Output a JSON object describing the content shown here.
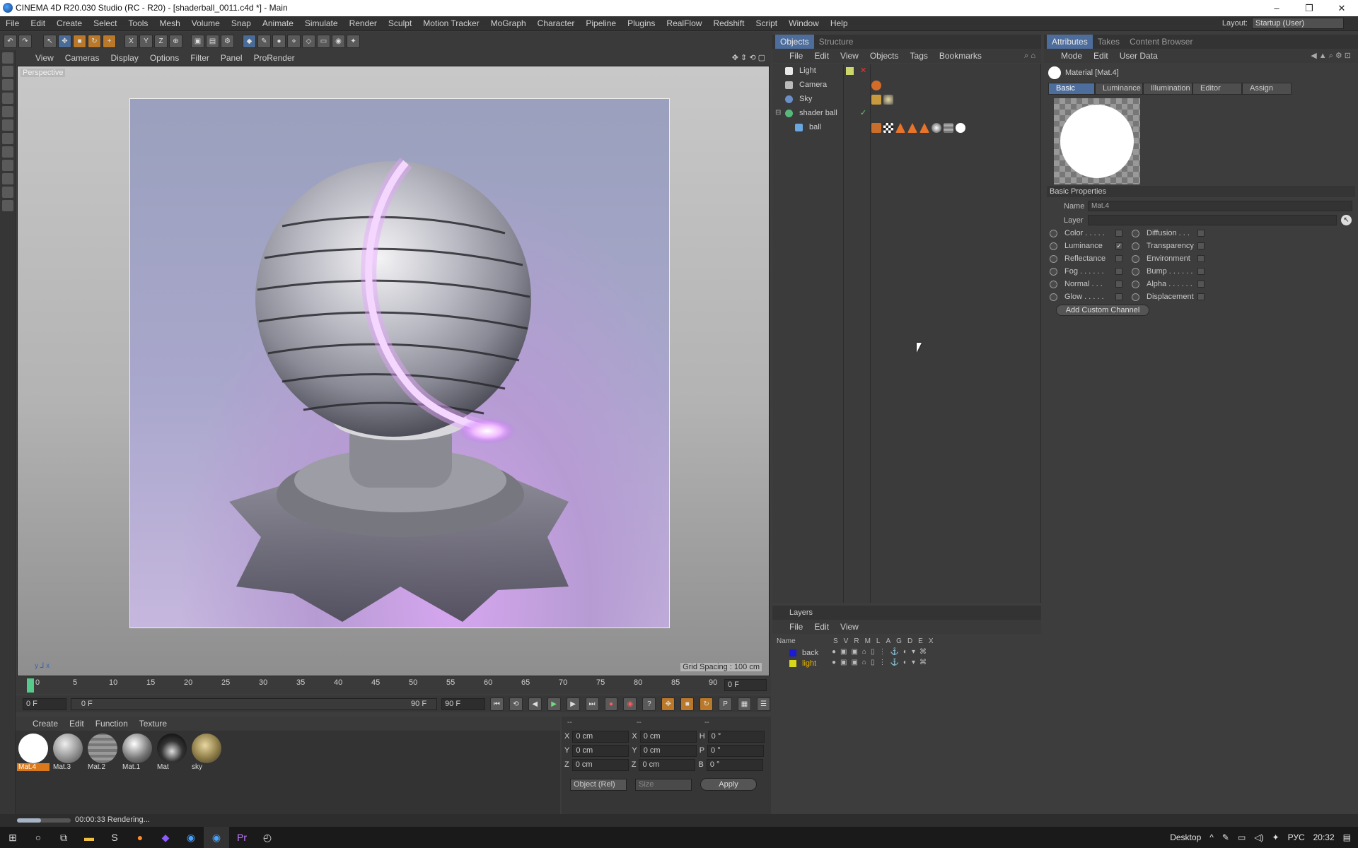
{
  "window": {
    "title": "CINEMA 4D R20.030 Studio (RC - R20) - [shaderball_0011.c4d *] - Main",
    "controls": [
      "–",
      "❐",
      "✕"
    ]
  },
  "menubar": {
    "items": [
      "File",
      "Edit",
      "Create",
      "Select",
      "Tools",
      "Mesh",
      "Volume",
      "Snap",
      "Animate",
      "Simulate",
      "Render",
      "Sculpt",
      "Motion Tracker",
      "MoGraph",
      "Character",
      "Pipeline",
      "Plugins",
      "RealFlow",
      "Redshift",
      "Script",
      "Window",
      "Help"
    ],
    "layout_label": "Layout:",
    "layout_value": "Startup (User)"
  },
  "viewport": {
    "menu": [
      "View",
      "Cameras",
      "Display",
      "Options",
      "Filter",
      "Panel",
      "ProRender"
    ],
    "label": "Perspective",
    "grid_spacing": "Grid Spacing : 100 cm"
  },
  "timeline": {
    "ticks": [
      "0",
      "5",
      "10",
      "15",
      "20",
      "25",
      "30",
      "35",
      "40",
      "45",
      "50",
      "55",
      "60",
      "65",
      "70",
      "75",
      "80",
      "85",
      "90"
    ],
    "current_frame": "0 F",
    "start_frame": "0 F",
    "range_start": "0 F",
    "range_end": "90 F",
    "end_frame": "90 F"
  },
  "material_manager": {
    "menu": [
      "Create",
      "Edit",
      "Function",
      "Texture"
    ],
    "materials": [
      {
        "name": "Mat.4",
        "selected": true
      },
      {
        "name": "Mat.3",
        "selected": false
      },
      {
        "name": "Mat.2",
        "selected": false
      },
      {
        "name": "Mat.1",
        "selected": false
      },
      {
        "name": "Mat",
        "selected": false
      },
      {
        "name": "sky",
        "selected": false
      }
    ]
  },
  "coordinates": {
    "header": [
      "--",
      "--",
      "--"
    ],
    "rows": [
      {
        "a": "X",
        "av": "0 cm",
        "b": "X",
        "bv": "0 cm",
        "c": "H",
        "cv": "0 °"
      },
      {
        "a": "Y",
        "av": "0 cm",
        "b": "Y",
        "bv": "0 cm",
        "c": "P",
        "cv": "0 °"
      },
      {
        "a": "Z",
        "av": "0 cm",
        "b": "Z",
        "bv": "0 cm",
        "c": "B",
        "cv": "0 °"
      }
    ],
    "mode": "Object (Rel)",
    "size_mode": "Size",
    "apply": "Apply"
  },
  "objects_panel": {
    "tabs": [
      "Objects",
      "Structure"
    ],
    "menu": [
      "File",
      "Edit",
      "View",
      "Objects",
      "Tags",
      "Bookmarks"
    ],
    "items": [
      "Light",
      "Camera",
      "Sky",
      "shader ball",
      "ball"
    ]
  },
  "layers_panel": {
    "title": "Layers",
    "menu": [
      "File",
      "Edit",
      "View"
    ],
    "columns": [
      "Name",
      "S",
      "V",
      "R",
      "M",
      "L",
      "A",
      "G",
      "D",
      "E",
      "X"
    ],
    "layers": [
      {
        "name": "back",
        "color": "#1b1bd6"
      },
      {
        "name": "light",
        "color": "#d6d61b"
      }
    ]
  },
  "attributes_panel": {
    "tabs": [
      "Attributes",
      "Takes",
      "Content Browser"
    ],
    "menu": [
      "Mode",
      "Edit",
      "User Data"
    ],
    "material_title": "Material [Mat.4]",
    "subtabs": [
      "Basic",
      "Luminance",
      "Illumination",
      "Editor",
      "Assign"
    ],
    "section": "Basic Properties",
    "name_label": "Name",
    "name_value": "Mat.4",
    "layer_label": "Layer",
    "channels_left": [
      {
        "label": "Color . . . . .",
        "checked": false
      },
      {
        "label": "Luminance",
        "checked": true
      },
      {
        "label": "Reflectance",
        "checked": false
      },
      {
        "label": "Fog . . . . . .",
        "checked": false
      },
      {
        "label": "Normal . . .",
        "checked": false
      },
      {
        "label": "Glow . . . . .",
        "checked": false
      }
    ],
    "channels_right": [
      {
        "label": "Diffusion . . .",
        "checked": false
      },
      {
        "label": "Transparency",
        "checked": false
      },
      {
        "label": "Environment",
        "checked": false
      },
      {
        "label": "Bump . . . . . .",
        "checked": false
      },
      {
        "label": "Alpha . . . . . .",
        "checked": false
      },
      {
        "label": "Displacement",
        "checked": false
      }
    ],
    "add_channel": "Add Custom Channel"
  },
  "status": {
    "text": "00:00:33 Rendering...",
    "progress": 0.45
  },
  "taskbar": {
    "desktop": "Desktop",
    "lang": "РУС",
    "time": "20:32"
  }
}
